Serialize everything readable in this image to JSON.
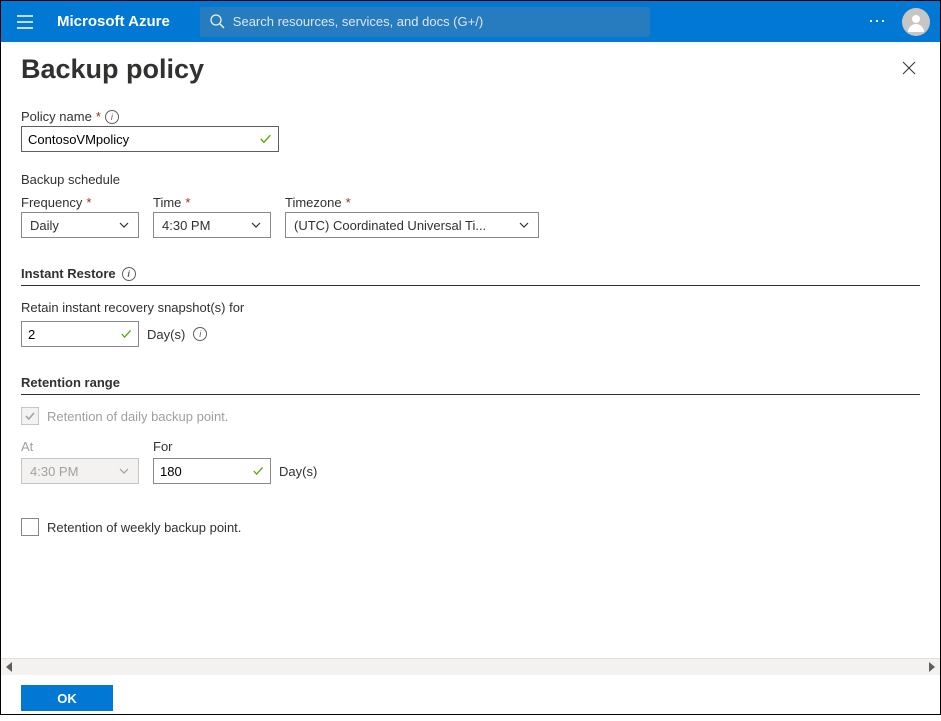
{
  "header": {
    "brand": "Microsoft Azure",
    "search_placeholder": "Search resources, services, and docs (G+/)"
  },
  "page": {
    "title": "Backup policy"
  },
  "policy": {
    "name_label": "Policy name",
    "name_value": "ContosoVMpolicy"
  },
  "schedule": {
    "section_label": "Backup schedule",
    "frequency_label": "Frequency",
    "frequency_value": "Daily",
    "time_label": "Time",
    "time_value": "4:30 PM",
    "timezone_label": "Timezone",
    "timezone_value": "(UTC) Coordinated Universal Ti..."
  },
  "instant_restore": {
    "heading": "Instant Restore",
    "retain_label": "Retain instant recovery snapshot(s) for",
    "value": "2",
    "unit": "Day(s)"
  },
  "retention": {
    "heading": "Retention range",
    "daily": {
      "checkbox_label": "Retention of daily backup point.",
      "checked": true,
      "at_label": "At",
      "at_value": "4:30 PM",
      "for_label": "For",
      "for_value": "180",
      "unit": "Day(s)"
    },
    "weekly": {
      "checkbox_label": "Retention of weekly backup point.",
      "checked": false
    }
  },
  "footer": {
    "ok_label": "OK"
  }
}
